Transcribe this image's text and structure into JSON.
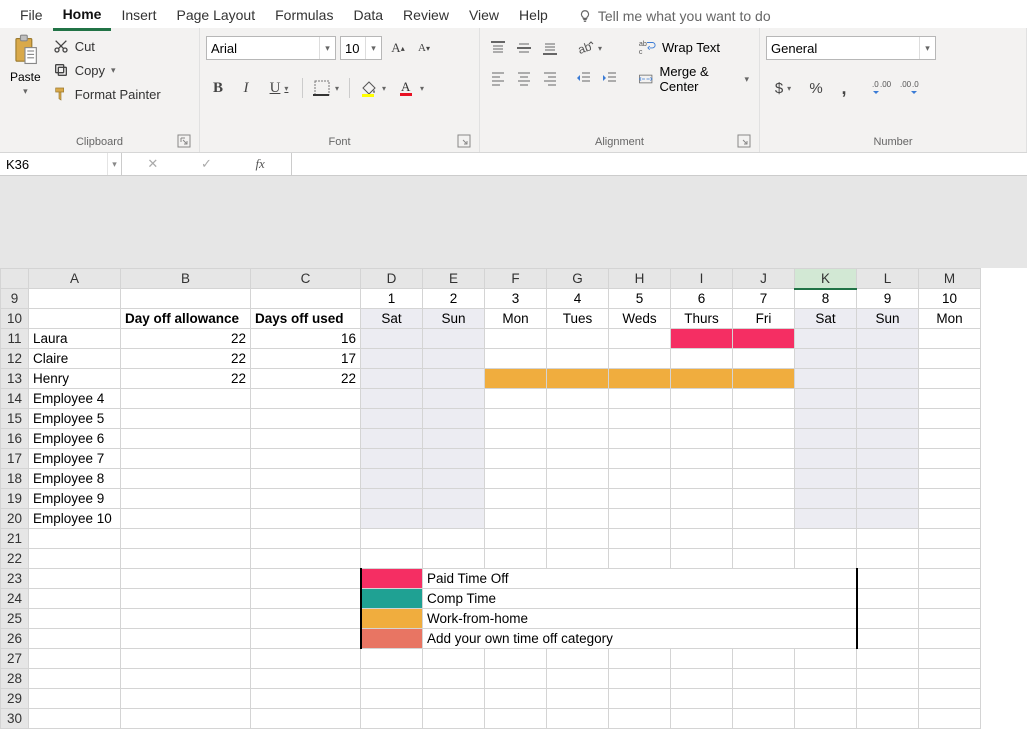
{
  "menu": {
    "tabs": [
      "File",
      "Home",
      "Insert",
      "Page Layout",
      "Formulas",
      "Data",
      "Review",
      "View",
      "Help"
    ],
    "active": "Home",
    "tellme": "Tell me what you want to do"
  },
  "ribbon": {
    "clipboard": {
      "label": "Clipboard",
      "paste": "Paste",
      "cut": "Cut",
      "copy": "Copy",
      "format_painter": "Format Painter"
    },
    "font": {
      "label": "Font",
      "name": "Arial",
      "size": "10"
    },
    "alignment": {
      "label": "Alignment",
      "wrap": "Wrap Text",
      "merge": "Merge & Center"
    },
    "number": {
      "label": "Number",
      "format": "General"
    }
  },
  "namebox": "K36",
  "sheet": {
    "columns": [
      "A",
      "B",
      "C",
      "D",
      "E",
      "F",
      "G",
      "H",
      "I",
      "J",
      "K",
      "L",
      "M"
    ],
    "selected_column": "K",
    "row9": {
      "nums": [
        "1",
        "2",
        "3",
        "4",
        "5",
        "6",
        "7",
        "8",
        "9",
        "10"
      ]
    },
    "row10": {
      "b": "Day off allowance",
      "c": "Days off used",
      "days": [
        "Sat",
        "Sun",
        "Mon",
        "Tues",
        "Weds",
        "Thurs",
        "Fri",
        "Sat",
        "Sun",
        "Mon"
      ]
    },
    "employees": [
      {
        "name": "Laura",
        "allow": "22",
        "used": "16",
        "cells": [
          "",
          "",
          "",
          "",
          "",
          "pto",
          "pto",
          "",
          "",
          ""
        ]
      },
      {
        "name": "Claire",
        "allow": "22",
        "used": "17",
        "cells": [
          "",
          "",
          "",
          "",
          "",
          "",
          "",
          "",
          "",
          ""
        ]
      },
      {
        "name": "Henry",
        "allow": "22",
        "used": "22",
        "cells": [
          "",
          "",
          "wfh",
          "wfh",
          "wfh",
          "wfh",
          "wfh",
          "",
          "",
          ""
        ]
      },
      {
        "name": "Employee 4",
        "allow": "",
        "used": "",
        "cells": [
          "",
          "",
          "",
          "",
          "",
          "",
          "",
          "",
          "",
          ""
        ]
      },
      {
        "name": "Employee 5",
        "allow": "",
        "used": "",
        "cells": [
          "",
          "",
          "",
          "",
          "",
          "",
          "",
          "",
          "",
          ""
        ]
      },
      {
        "name": "Employee 6",
        "allow": "",
        "used": "",
        "cells": [
          "",
          "",
          "",
          "",
          "",
          "",
          "",
          "",
          "",
          ""
        ]
      },
      {
        "name": "Employee 7",
        "allow": "",
        "used": "",
        "cells": [
          "",
          "",
          "",
          "",
          "",
          "",
          "",
          "",
          "",
          ""
        ]
      },
      {
        "name": "Employee 8",
        "allow": "",
        "used": "",
        "cells": [
          "",
          "",
          "",
          "",
          "",
          "",
          "",
          "",
          "",
          ""
        ]
      },
      {
        "name": "Employee 9",
        "allow": "",
        "used": "",
        "cells": [
          "",
          "",
          "",
          "",
          "",
          "",
          "",
          "",
          "",
          ""
        ]
      },
      {
        "name": "Employee 10",
        "allow": "",
        "used": "",
        "cells": [
          "",
          "",
          "",
          "",
          "",
          "",
          "",
          "",
          "",
          ""
        ]
      }
    ],
    "weekend_day_indexes": [
      0,
      1,
      7,
      8
    ],
    "legend": [
      {
        "color": "pto",
        "label": "Paid Time Off"
      },
      {
        "color": "comp",
        "label": "Comp Time"
      },
      {
        "color": "wfh",
        "label": "Work-from-home"
      },
      {
        "color": "own",
        "label": "Add your own time off category"
      }
    ]
  }
}
